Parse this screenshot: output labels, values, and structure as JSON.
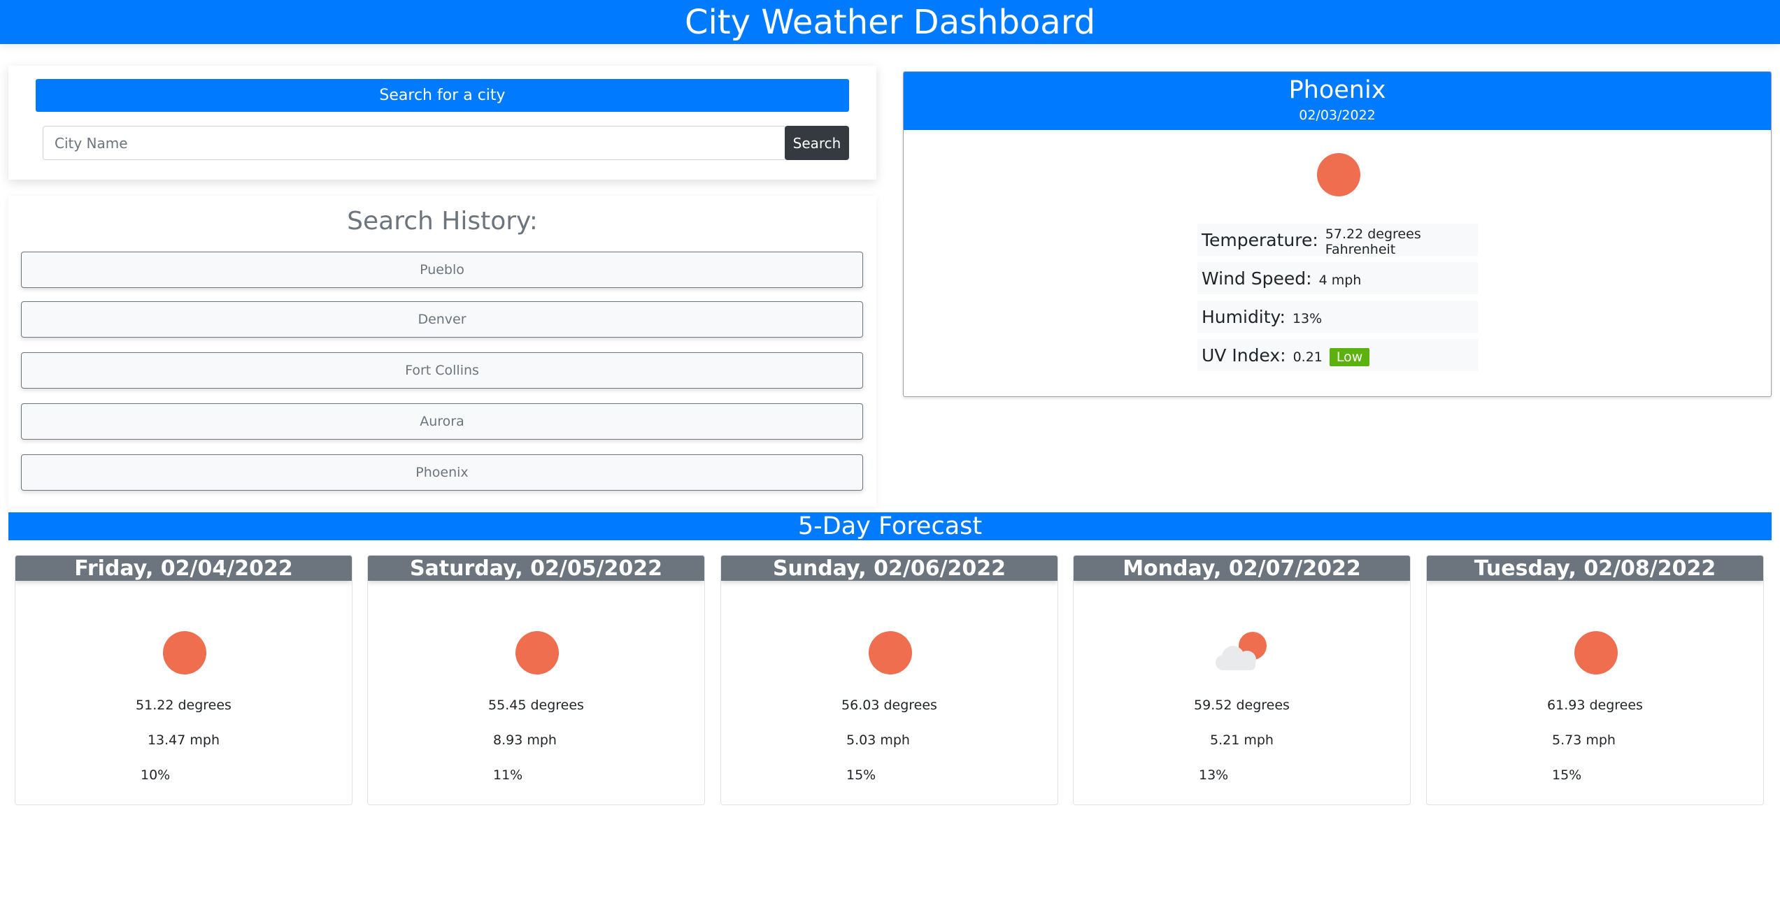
{
  "header": {
    "title": "City Weather Dashboard"
  },
  "search": {
    "title": "Search for a city",
    "placeholder": "City Name",
    "button_label": "Search"
  },
  "history": {
    "title": "Search History:",
    "items": [
      "Pueblo",
      "Denver",
      "Fort Collins",
      "Aurora",
      "Phoenix"
    ]
  },
  "current": {
    "city": "Phoenix",
    "date": "02/03/2022",
    "icon": "sun-icon",
    "temperature_label": "Temperature:",
    "temperature_value": "57.22 degrees Fahrenheit",
    "wind_label": "Wind Speed:",
    "wind_value": "4 mph",
    "humidity_label": "Humidity:",
    "humidity_value": "13%",
    "uv_label": "UV Index:",
    "uv_value": "0.21",
    "uv_badge": "Low"
  },
  "forecast": {
    "title": "5-Day Forecast",
    "days": [
      {
        "date": "Friday, 02/04/2022",
        "icon": "sun-icon",
        "temp": "51.22 degrees",
        "wind": "13.47 mph",
        "humidity": "10%"
      },
      {
        "date": "Saturday, 02/05/2022",
        "icon": "sun-icon",
        "temp": "55.45 degrees",
        "wind": "8.93 mph",
        "humidity": "11%"
      },
      {
        "date": "Sunday, 02/06/2022",
        "icon": "sun-icon",
        "temp": "56.03 degrees",
        "wind": "5.03 mph",
        "humidity": "15%"
      },
      {
        "date": "Monday, 02/07/2022",
        "icon": "partly-cloudy-icon",
        "temp": "59.52 degrees",
        "wind": "5.21 mph",
        "humidity": "13%"
      },
      {
        "date": "Tuesday, 02/08/2022",
        "icon": "sun-icon",
        "temp": "61.93 degrees",
        "wind": "5.73 mph",
        "humidity": "15%"
      }
    ]
  },
  "colors": {
    "primary": "#007bff",
    "dark": "#343a40",
    "secondary": "#6c757d",
    "sun": "#ee6e4f",
    "uv_low": "#5bb20c"
  }
}
